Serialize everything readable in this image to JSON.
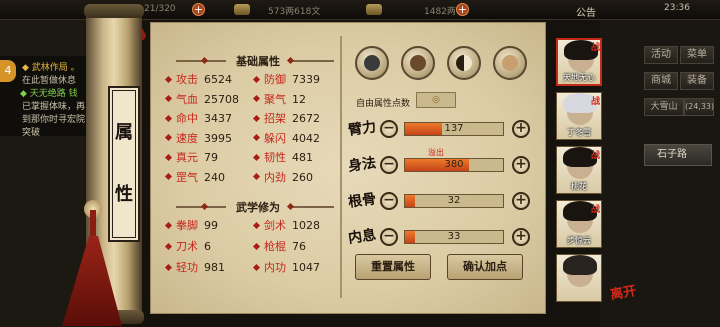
{
  "topbar": {
    "partial_left": "体力",
    "stamina": "21/320",
    "currency": "573两618文",
    "gold": "1482两",
    "announce": "公告",
    "clock": "23:36"
  },
  "quest_log": {
    "line1": "◆ 武林作局 。",
    "line2": "在此暂做休息",
    "line3": "◆ 天无绝路 钱",
    "line4": "已掌握体味，再",
    "line5": "到那你时寻宏院",
    "line6": "突破"
  },
  "right_menu": {
    "b1": "活动",
    "b2": "菜单",
    "b3": "商城",
    "b4": "装备",
    "b5": "大雪山",
    "b5_coord": "(24,33)",
    "location": "石子路"
  },
  "scroll_label": {
    "c1": "属",
    "c2": "性"
  },
  "base": {
    "title": "基础属性",
    "stats": [
      {
        "name": "攻击",
        "value": "6524"
      },
      {
        "name": "防御",
        "value": "7339"
      },
      {
        "name": "气血",
        "value": "25708"
      },
      {
        "name": "聚气",
        "value": "12"
      },
      {
        "name": "命中",
        "value": "3437"
      },
      {
        "name": "招架",
        "value": "2672"
      },
      {
        "name": "速度",
        "value": "3995"
      },
      {
        "name": "躲闪",
        "value": "4042"
      },
      {
        "name": "真元",
        "value": "79"
      },
      {
        "name": "韧性",
        "value": "481"
      },
      {
        "name": "罡气",
        "value": "240"
      },
      {
        "name": "内劲",
        "value": "260"
      }
    ]
  },
  "martial": {
    "title": "武学修为",
    "stats": [
      {
        "name": "拳脚",
        "value": "99"
      },
      {
        "name": "剑术",
        "value": "1028"
      },
      {
        "name": "刀术",
        "value": "6"
      },
      {
        "name": "枪棍",
        "value": "76"
      },
      {
        "name": "轻功",
        "value": "981"
      },
      {
        "name": "内功",
        "value": "1047"
      }
    ]
  },
  "attr": {
    "free_label": "自由属性点数",
    "free_value": "◎",
    "rows": [
      {
        "label": "臂力",
        "value": 137,
        "fill": 0.38,
        "minus": "−",
        "plus": "+"
      },
      {
        "label": "身法",
        "value": 380,
        "fill": 0.65,
        "minus": "−",
        "plus": "+"
      },
      {
        "label": "根骨",
        "value": 32,
        "fill": 0.1,
        "minus": "−",
        "plus": "+"
      },
      {
        "label": "内息",
        "value": 33,
        "fill": 0.1,
        "minus": "−",
        "plus": "+"
      }
    ],
    "overflow_tag": "溢出",
    "reset_button": "重置属性",
    "confirm_button": "确认加点"
  },
  "characters": [
    {
      "name": "天地无心",
      "tag": "战"
    },
    {
      "name": "丁冬雪",
      "tag": "战"
    },
    {
      "name": "桃花",
      "tag": "战"
    },
    {
      "name": "步惊云",
      "tag": "战"
    },
    {
      "name": "",
      "tag": ""
    }
  ],
  "seal": "离开",
  "colors": {
    "accent_red": "#c4281c",
    "bar_fill": "#ee7a2a",
    "parchment": "#e7dab9"
  }
}
